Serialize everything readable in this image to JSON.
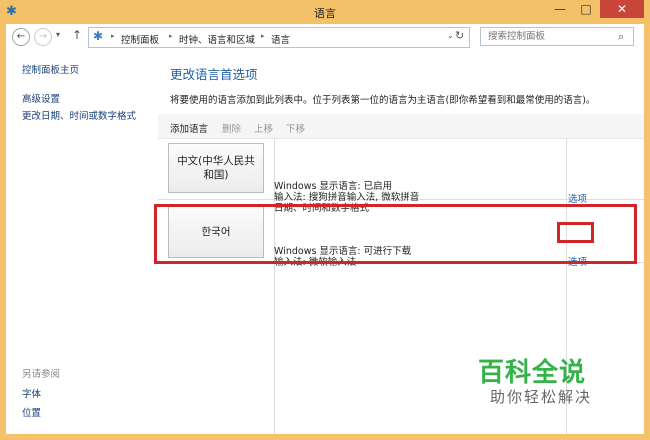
{
  "window": {
    "title": "语言",
    "controls": {
      "minimize": "—",
      "maximize": "□",
      "close": "✕"
    }
  },
  "nav": {
    "back": "←",
    "forward": "→",
    "recent": "▾",
    "up": "↑",
    "refresh": "↻",
    "dropdown": "⌄"
  },
  "breadcrumb": [
    "控制面板",
    "时钟、语言和区域",
    "语言"
  ],
  "search": {
    "placeholder": "搜索控制面板",
    "icon": "⌕"
  },
  "sidebar": {
    "home": "控制面板主页",
    "links": [
      "高级设置",
      "更改日期、时间或数字格式"
    ],
    "see_also": {
      "heading": "另请参阅",
      "links": [
        "字体",
        "位置"
      ]
    }
  },
  "main": {
    "heading": "更改语言首选项",
    "description": "将要使用的语言添加到此列表中。位于列表第一位的语言为主语言(即你希望看到和最常使用的语言)。",
    "toolbar": {
      "add": "添加语言",
      "delete": "删除",
      "move_up": "上移",
      "move_down": "下移"
    },
    "languages": [
      {
        "name": "中文(中华人民共和国)",
        "info": [
          "Windows 显示语言: 已启用",
          "输入法: 搜狗拼音输入法, 微软拼音",
          "日期、时间和数字格式"
        ],
        "options": "选项"
      },
      {
        "name": "한국어",
        "info": [
          "Windows 显示语言: 可进行下载",
          "输入法: 微软输入法"
        ],
        "options": "选项"
      }
    ]
  },
  "watermark": {
    "title": "百科全说",
    "subtitle": "助你轻松解决"
  },
  "colors": {
    "titlebar": "#f2c168",
    "close": "#c9453a",
    "link": "#1f5fa8",
    "highlight": "#d0262b",
    "watermark": "#35b34a"
  }
}
